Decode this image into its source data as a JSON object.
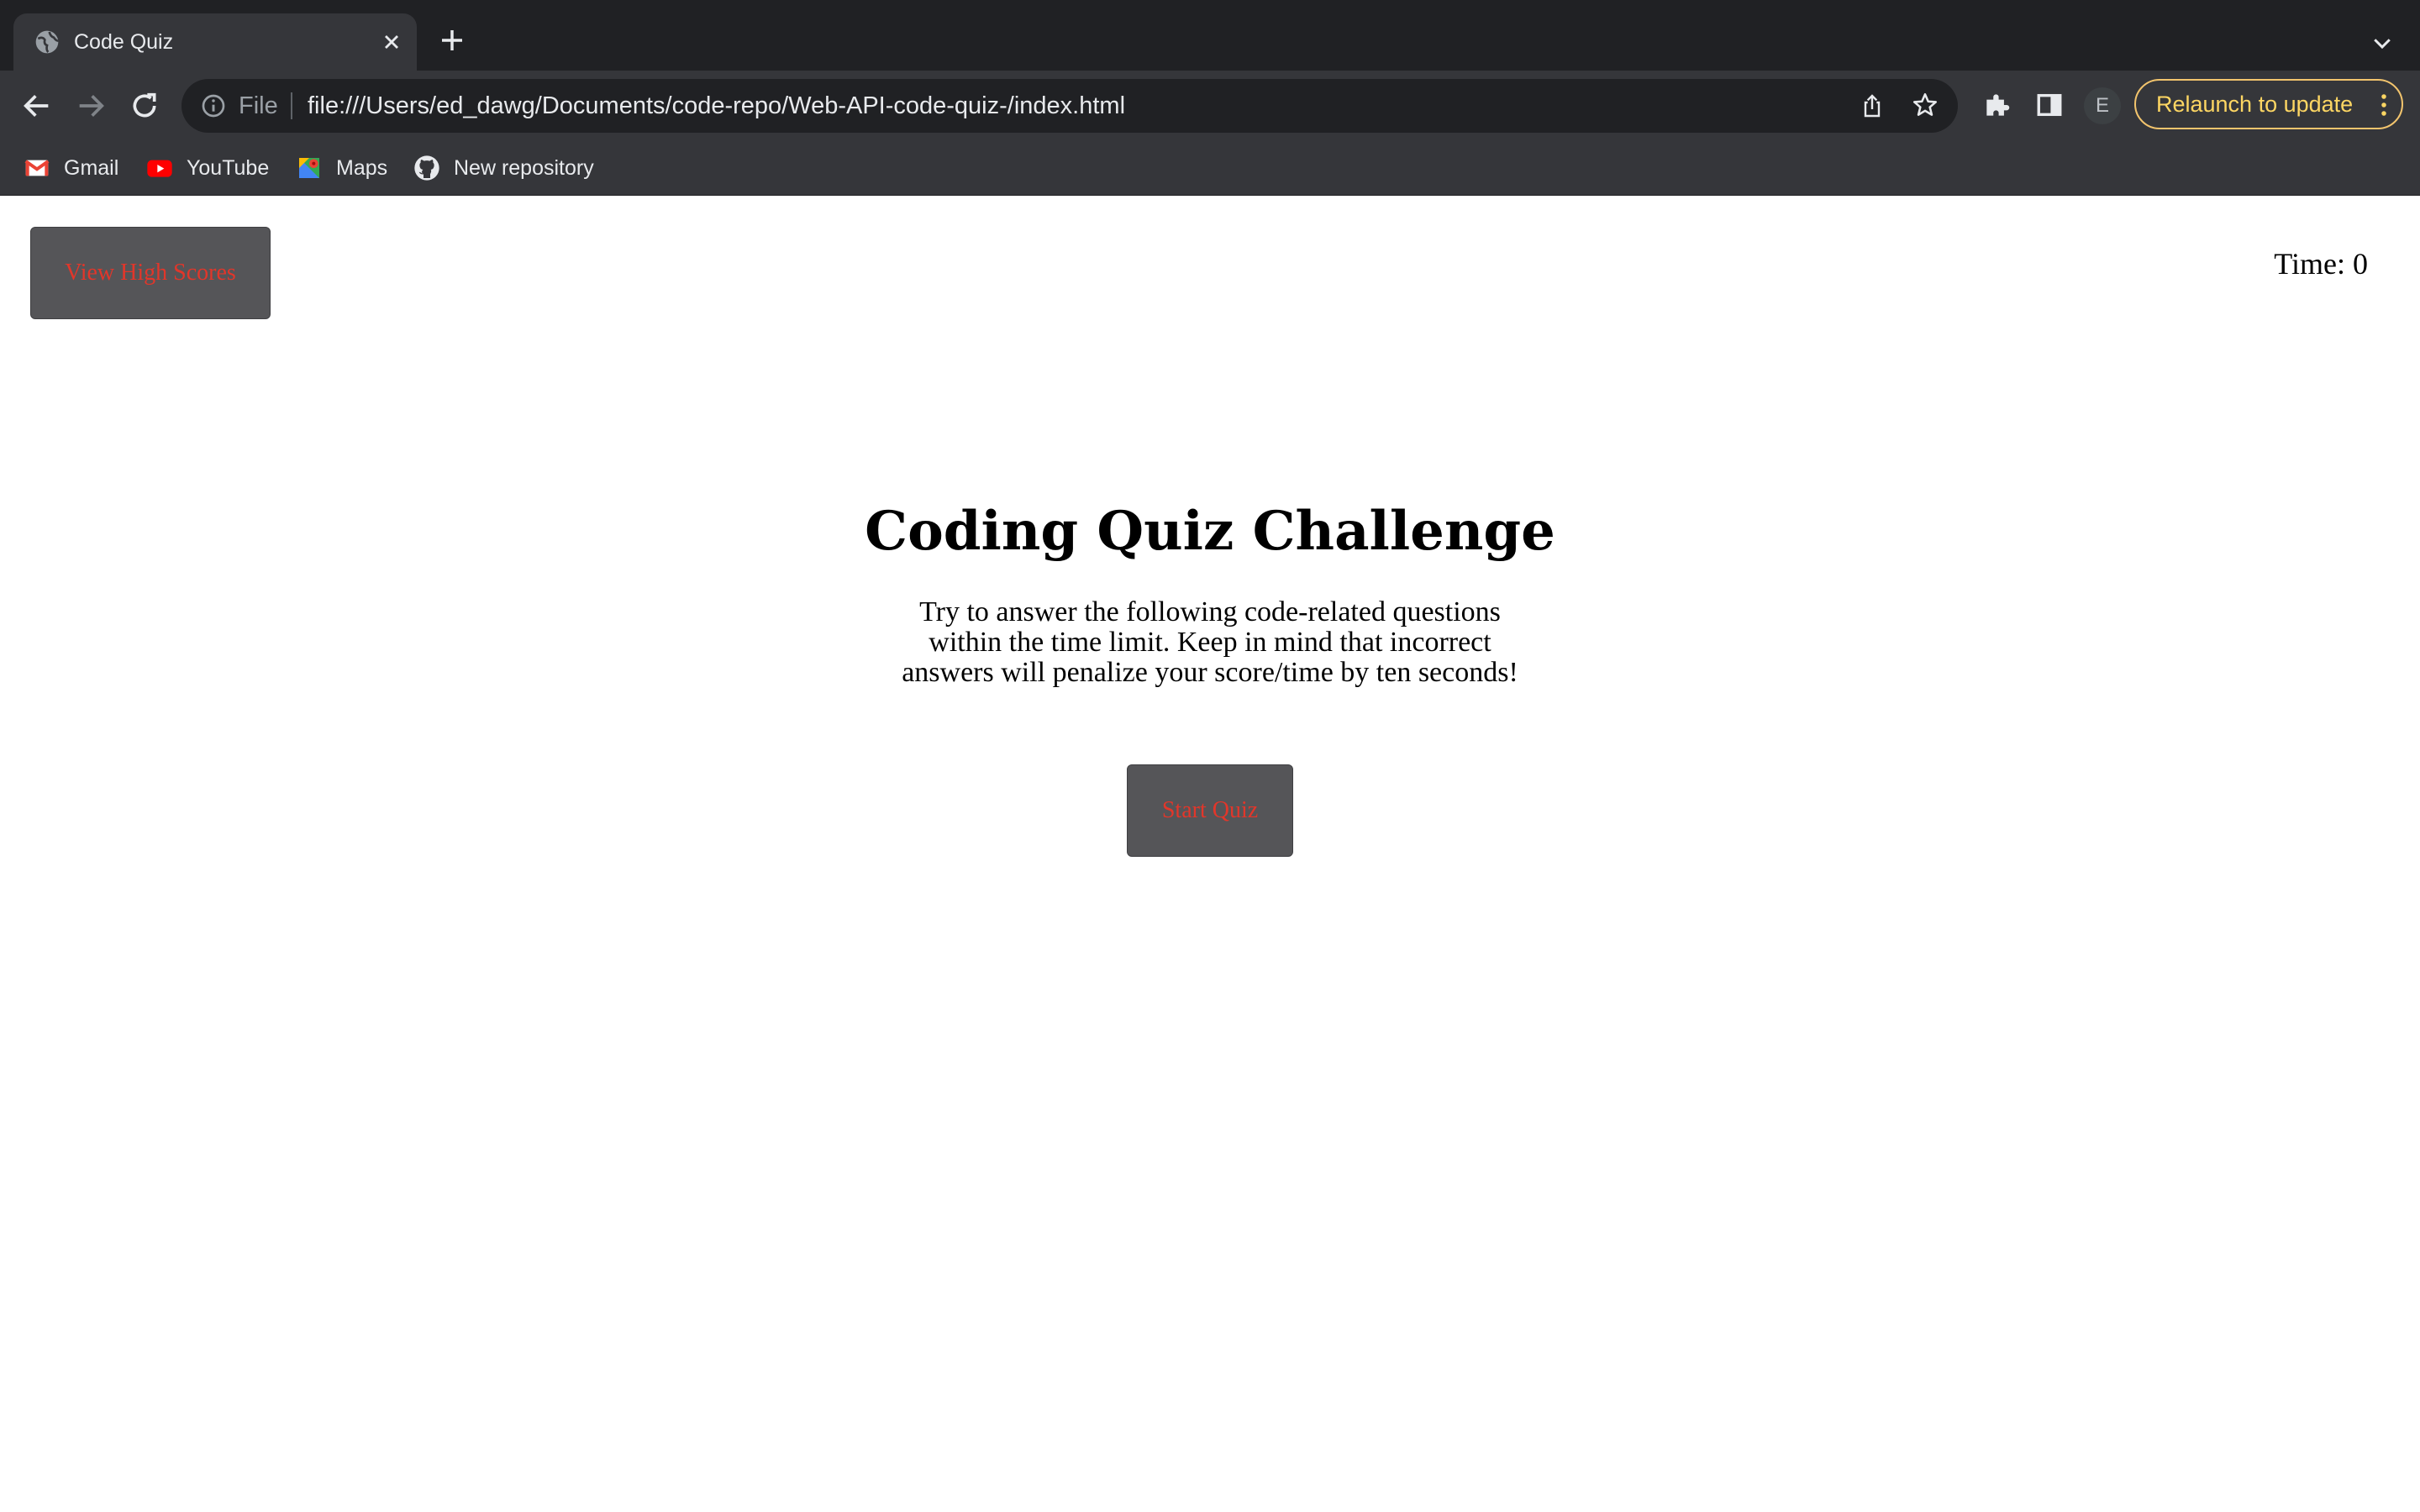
{
  "browser": {
    "tab_title": "Code Quiz",
    "omnibox": {
      "scheme_label": "File",
      "url": "file:///Users/ed_dawg/Documents/code-repo/Web-API-code-quiz-/index.html"
    },
    "profile_initial": "E",
    "relaunch_label": "Relaunch to update",
    "bookmarks": [
      {
        "label": "Gmail",
        "icon": "gmail-icon"
      },
      {
        "label": "YouTube",
        "icon": "youtube-icon"
      },
      {
        "label": "Maps",
        "icon": "maps-icon"
      },
      {
        "label": "New repository",
        "icon": "github-icon"
      }
    ],
    "colors": {
      "tabstrip": "#202124",
      "toolbar": "#35363a",
      "relaunch_accent": "#fdd663"
    }
  },
  "page": {
    "high_scores_label": "View High Scores",
    "timer_label": "Time: 0",
    "heading": "Coding Quiz Challenge",
    "intro": "Try to answer the following code-related questions within the time limit. Keep in mind that incorrect answers will penalize your score/time by ten seconds!",
    "start_label": "Start Quiz",
    "colors": {
      "button_bg": "#555558",
      "button_text": "#e2362a"
    }
  }
}
